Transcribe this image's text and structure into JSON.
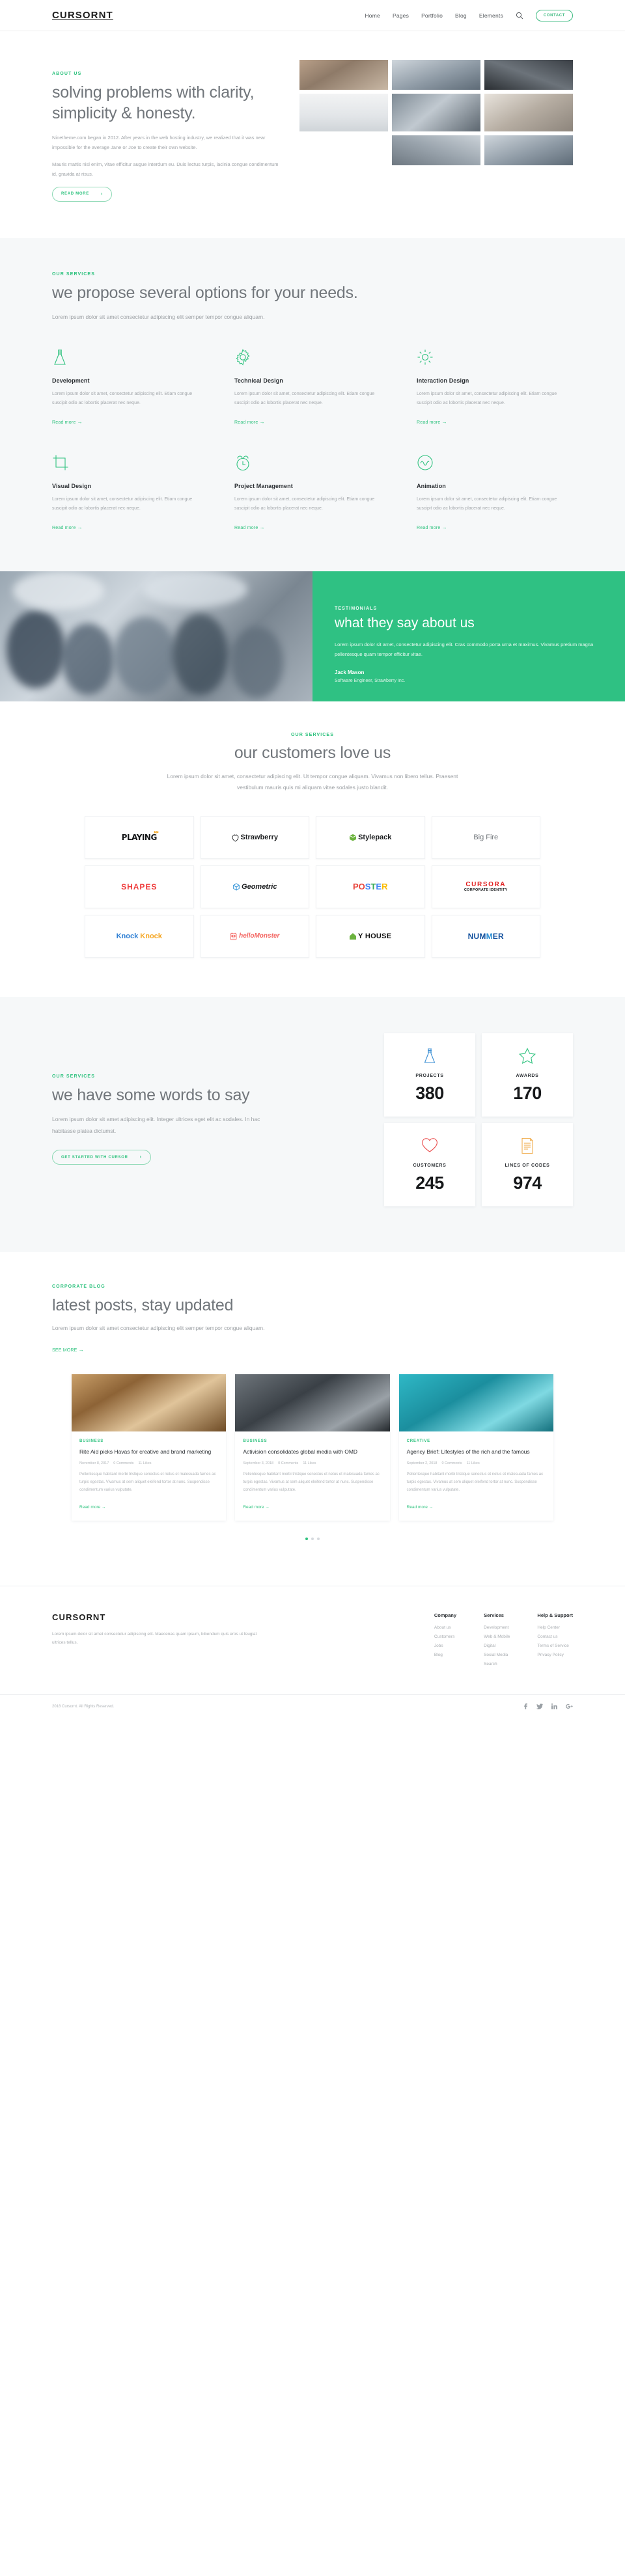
{
  "brand": {
    "name": "CURSORNT",
    "accent": "#2ec27e",
    "accent_dark": "#2fc183"
  },
  "header": {
    "logo": "CURSORNT",
    "nav": [
      {
        "label": "Home"
      },
      {
        "label": "Pages"
      },
      {
        "label": "Portfolio"
      },
      {
        "label": "Blog"
      },
      {
        "label": "Elements"
      }
    ],
    "search_icon": "search-icon",
    "contact_label": "CONTACT"
  },
  "about": {
    "eyebrow": "ABOUT US",
    "title": "solving problems with clarity, simplicity & honesty.",
    "paragraph_1": "Ninetheme.com began in 2012. After years in the web hosting industry, we realized that it was near impossible for the average Jane or Joe to create their own website.",
    "paragraph_2": "Mauris mattis nisl enim, vitae efficitur augue interdum eu. Duis lectus turpis, lacinia congue condimentum id, gravida at risus.",
    "button": "READ MORE",
    "gallery": [
      {
        "name": "office-desk-photo"
      },
      {
        "name": "team-meeting-photo"
      },
      {
        "name": "camera-lens-photo"
      },
      {
        "name": "workspace-white-photo"
      },
      {
        "name": "coworking-photo"
      },
      {
        "name": "person-laptop-photo"
      },
      {
        "name": "meeting-room-photo"
      }
    ]
  },
  "services": {
    "eyebrow": "OUR SERVICES",
    "title": "we propose several options for your needs.",
    "lede": "Lorem ipsum dolor sit amet consectetur adipiscing elit semper tempor congue aliquam.",
    "read_more": "Read more",
    "items": [
      {
        "icon": "flask-icon",
        "title": "Development",
        "text": "Lorem ipsum dolor sit amet, consectetur adipiscing elit. Etiam congue suscipit odio ac lobortis placerat nec neque."
      },
      {
        "icon": "gear-icon",
        "title": "Technical Design",
        "text": "Lorem ipsum dolor sit amet, consectetur adipiscing elit. Etiam congue suscipit odio ac lobortis placerat nec neque."
      },
      {
        "icon": "sun-icon",
        "title": "Interaction Design",
        "text": "Lorem ipsum dolor sit amet, consectetur adipiscing elit. Etiam congue suscipit odio ac lobortis placerat nec neque."
      },
      {
        "icon": "crop-icon",
        "title": "Visual Design",
        "text": "Lorem ipsum dolor sit amet, consectetur adipiscing elit. Etiam congue suscipit odio ac lobortis placerat nec neque."
      },
      {
        "icon": "alarm-clock-icon",
        "title": "Project Management",
        "text": "Lorem ipsum dolor sit amet, consectetur adipiscing elit. Etiam congue suscipit odio ac lobortis placerat nec neque."
      },
      {
        "icon": "wave-circle-icon",
        "title": "Animation",
        "text": "Lorem ipsum dolor sit amet, consectetur adipiscing elit. Etiam congue suscipit odio ac lobortis placerat nec neque."
      }
    ]
  },
  "testimonials": {
    "eyebrow": "TESTIMONIALS",
    "title": "what they say about us",
    "quote": "Lorem ipsum dolor sit amet, consectetur adipiscing elit. Cras commodo porta urna et maximus. Vivamus pretium magna pellentesque quam tempor efficitur vitae.",
    "author": "Jack Mason",
    "role": "Software Engineer, Strawberry Inc.",
    "image_name": "team-photo"
  },
  "customers": {
    "eyebrow": "OUR SERVICES",
    "title": "our customers love us",
    "lede": "Lorem ipsum dolor sit amet, consectetur adipiscing elit. Ut tempor congue aliquam. Vivamus non libero tellus. Praesent vestibulum mauris quis mi aliquam vitae sodales justo blandit.",
    "logos": [
      {
        "name": "PLAYING"
      },
      {
        "name": "Strawberry"
      },
      {
        "name": "Stylepack"
      },
      {
        "name": "BigFire"
      },
      {
        "name": "SHAPES"
      },
      {
        "name": "Geometric"
      },
      {
        "name": "POSTER"
      },
      {
        "name": "CURSORA",
        "sub": "CORPORATE IDENTITY"
      },
      {
        "name": "Knock Knock"
      },
      {
        "name": "helloMonster"
      },
      {
        "name": "MY HOUSE"
      },
      {
        "name": "NUMMER"
      }
    ]
  },
  "stats": {
    "eyebrow": "OUR SERVICES",
    "title": "we have some words to say",
    "lede": "Lorem ipsum dolor sit amet adipiscing elit. Integer ultrices eget elit ac sodales. In hac habitasse platea dictumst.",
    "button": "GET STARTED WITH CURSOR",
    "cards": [
      {
        "icon": "flask-icon",
        "icon_color": "#3b8fd4",
        "label": "PROJECTS",
        "value": "380"
      },
      {
        "icon": "star-icon",
        "icon_color": "#2ec27e",
        "label": "AWARDS",
        "value": "170"
      },
      {
        "icon": "heart-icon",
        "icon_color": "#ea4d4d",
        "label": "CUSTOMERS",
        "value": "245"
      },
      {
        "icon": "document-icon",
        "icon_color": "#f0ad4e",
        "label": "LINES OF CODES",
        "value": "974"
      }
    ]
  },
  "blog": {
    "eyebrow": "CORPORATE BLOG",
    "title": "latest posts, stay updated",
    "lede": "Lorem ipsum dolor sit amet consectetur adipiscing elit semper tempor congue aliquam.",
    "button": "SEE MORE",
    "read_more": "Read more",
    "posts": [
      {
        "image_name": "wood-texture-photo",
        "category": "BUSINESS",
        "title": "Rite Aid picks Havas for creative and brand marketing",
        "date": "November 8, 2017",
        "comments": "0 Comments",
        "likes": "11 Likes",
        "excerpt": "Pellentesque habitant morbi tristique senectus et netus et malesuada fames ac turpis egestas. Vivamus at sem aliquet eleifend tortor at nunc. Suspendisse condimentum varius vulputate."
      },
      {
        "image_name": "surf-wave-photo",
        "category": "BUSINESS",
        "title": "Activision consolidates global media with OMD",
        "date": "September 3, 2018",
        "comments": "0 Comments",
        "likes": "11 Likes",
        "excerpt": "Pellentesque habitant morbi tristique senectus et netus et malesuada fames ac turpis egestas. Vivamus at sem aliquet eleifend tortor at nunc. Suspendisse condimentum varius vulputate."
      },
      {
        "image_name": "turquoise-water-photo",
        "category": "CREATIVE",
        "title": "Agency Brief: Lifestyles of the rich and the famous",
        "date": "September 2, 2018",
        "comments": "0 Comments",
        "likes": "11 Likes",
        "excerpt": "Pellentesque habitant morbi tristique senectus et netus et malesuada fames ac turpis egestas. Vivamus at sem aliquet eleifend tortor at nunc. Suspendisse condimentum varius vulputate."
      }
    ]
  },
  "footer": {
    "logo": "CURSORNT",
    "about": "Lorem ipsum dolor sit amet consectetur adipiscing elit. Maecenas quam ipsum, bibendum quis eros ut feugiat ultrices tellus.",
    "columns": [
      {
        "heading": "Company",
        "links": [
          "About us",
          "Customers",
          "Jobs",
          "Blog"
        ]
      },
      {
        "heading": "Services",
        "links": [
          "Development",
          "Web & Mobile",
          "Digital",
          "Social Media",
          "Search"
        ]
      },
      {
        "heading": "Help & Support",
        "links": [
          "Help Center",
          "Contact us",
          "Terms of Service",
          "Privacy Policy"
        ]
      }
    ],
    "copyright": "2018 Cursornt. All Rights Reserved.",
    "socials": [
      "facebook-icon",
      "twitter-icon",
      "linkedin-icon",
      "google-plus-icon"
    ]
  }
}
